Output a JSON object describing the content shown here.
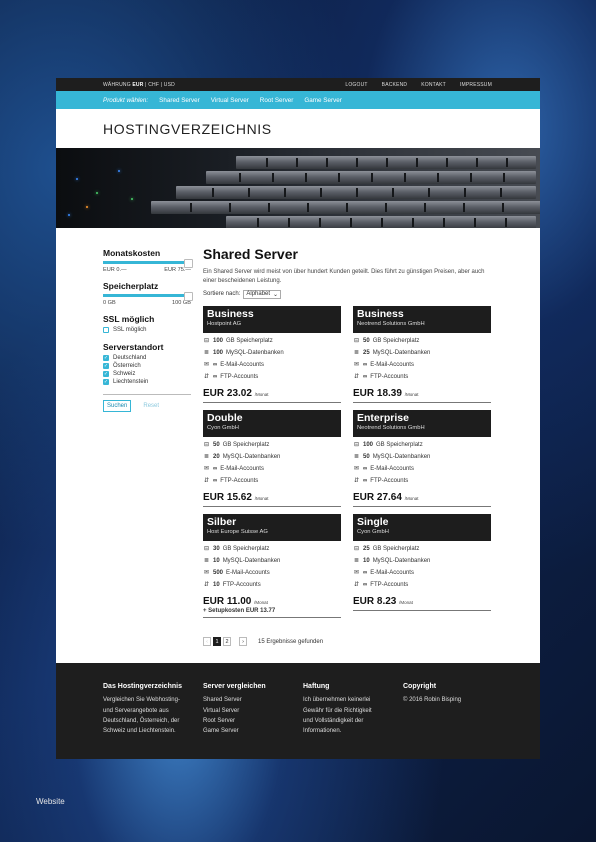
{
  "topbar": {
    "currency_label": "WÄHRUNG",
    "currency_active": "EUR",
    "currency_rest": "| CHF | USD",
    "links": [
      "LOGOUT",
      "BACKEND",
      "KONTAKT",
      "IMPRESSUM"
    ]
  },
  "nav": {
    "label": "Produkt wählen:",
    "items": [
      "Shared Server",
      "Virtual Server",
      "Root Server",
      "Game Server"
    ]
  },
  "brand": "HOSTINGVERZEICHNIS",
  "sidebar": {
    "monthly": {
      "title": "Monatskosten",
      "min": "EUR 0.—",
      "max": "EUR 75.—"
    },
    "storage": {
      "title": "Speicherplatz",
      "min": "0 GB",
      "max": "100 GB"
    },
    "ssl": {
      "title": "SSL möglich",
      "option": "SSL möglich"
    },
    "location": {
      "title": "Serverstandort",
      "options": [
        "Deutschland",
        "Österreich",
        "Schweiz",
        "Liechtenstein"
      ]
    },
    "search_label": "Suchen",
    "reset_label": "Reset"
  },
  "main": {
    "title": "Shared Server",
    "intro": "Ein Shared Server wird meist von über hundert Kunden geteilt. Dies führt zu günstigen Preisen, aber auch einer bescheidenen Leistung.",
    "sort_label": "Sortiere nach:",
    "sort_value": "Alphabet",
    "per_month": "/Monat",
    "cards": [
      {
        "title": "Business",
        "provider": "Hostpoint AG",
        "storage_val": "100",
        "storage_lbl": "GB Speicherplatz",
        "db_val": "100",
        "db_lbl": "MySQL-Datenbanken",
        "mail_val": "∞",
        "mail_lbl": "E-Mail-Accounts",
        "ftp_val": "∞",
        "ftp_lbl": "FTP-Accounts",
        "price": "EUR 23.02",
        "setup": ""
      },
      {
        "title": "Business",
        "provider": "Neotrend Solutions GmbH",
        "storage_val": "50",
        "storage_lbl": "GB Speicherplatz",
        "db_val": "25",
        "db_lbl": "MySQL-Datenbanken",
        "mail_val": "∞",
        "mail_lbl": "E-Mail-Accounts",
        "ftp_val": "∞",
        "ftp_lbl": "FTP-Accounts",
        "price": "EUR 18.39",
        "setup": ""
      },
      {
        "title": "Double",
        "provider": "Cyon GmbH",
        "storage_val": "50",
        "storage_lbl": "GB Speicherplatz",
        "db_val": "20",
        "db_lbl": "MySQL-Datenbanken",
        "mail_val": "∞",
        "mail_lbl": "E-Mail-Accounts",
        "ftp_val": "∞",
        "ftp_lbl": "FTP-Accounts",
        "price": "EUR 15.62",
        "setup": ""
      },
      {
        "title": "Enterprise",
        "provider": "Neotrend Solutions GmbH",
        "storage_val": "100",
        "storage_lbl": "GB Speicherplatz",
        "db_val": "50",
        "db_lbl": "MySQL-Datenbanken",
        "mail_val": "∞",
        "mail_lbl": "E-Mail-Accounts",
        "ftp_val": "∞",
        "ftp_lbl": "FTP-Accounts",
        "price": "EUR 27.64",
        "setup": ""
      },
      {
        "title": "Silber",
        "provider": "Host Europe Suisse AG",
        "storage_val": "30",
        "storage_lbl": "GB Speicherplatz",
        "db_val": "10",
        "db_lbl": "MySQL-Datenbanken",
        "mail_val": "500",
        "mail_lbl": "E-Mail-Accounts",
        "ftp_val": "10",
        "ftp_lbl": "FTP-Accounts",
        "price": "EUR 11.00",
        "setup": "+ Setupkosten EUR 13.77"
      },
      {
        "title": "Single",
        "provider": "Cyon GmbH",
        "storage_val": "25",
        "storage_lbl": "GB Speicherplatz",
        "db_val": "10",
        "db_lbl": "MySQL-Datenbanken",
        "mail_val": "∞",
        "mail_lbl": "E-Mail-Accounts",
        "ftp_val": "∞",
        "ftp_lbl": "FTP-Accounts",
        "price": "EUR 8.23",
        "setup": ""
      }
    ]
  },
  "pager": {
    "prev": "‹",
    "pages": [
      "1",
      "2"
    ],
    "next": "›",
    "results": "15 Ergebnisse gefunden"
  },
  "footer": [
    {
      "title": "Das Hostingverzeichnis",
      "lines": [
        "Vergleichen Sie Webhosting-",
        "und Serverangebote aus",
        "Deutschland, Österreich, der",
        "Schweiz und Liechtenstein."
      ]
    },
    {
      "title": "Server vergleichen",
      "lines": [
        "Shared Server",
        "Virtual Server",
        "Root Server",
        "Game Server"
      ]
    },
    {
      "title": "Haftung",
      "lines": [
        "Ich übernehmen keinerlei",
        "Gewähr für die Richtigkeit",
        "und Vollständigkeit der",
        "Informationen."
      ]
    },
    {
      "title": "Copyright",
      "lines": [
        "© 2016 Robin Bisping"
      ]
    }
  ],
  "caption": "Website",
  "colors": {
    "accent": "#36b6d6",
    "dark": "#1e1e1e"
  }
}
